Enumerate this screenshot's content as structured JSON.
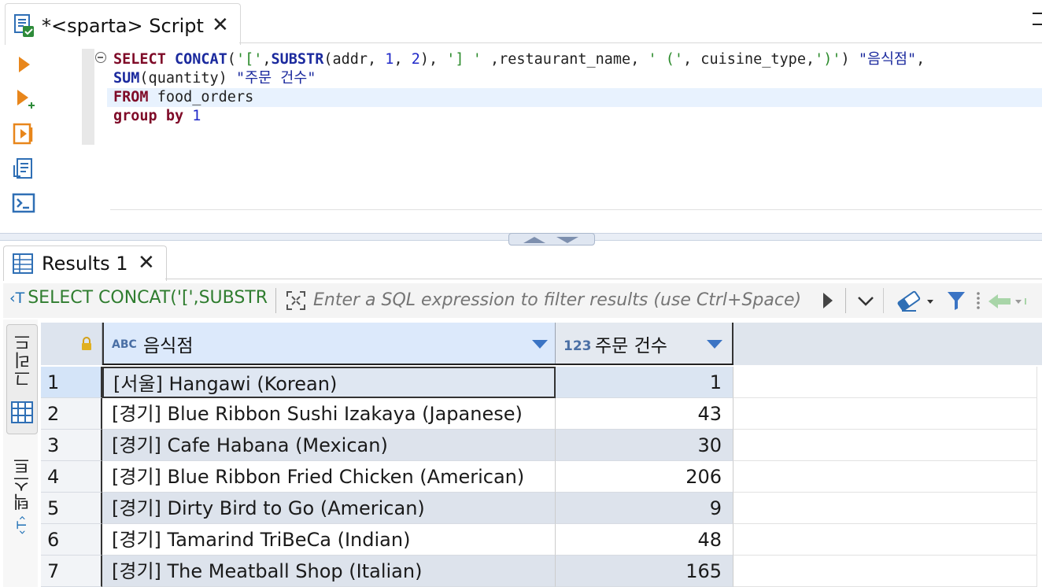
{
  "editor": {
    "tab_title": "*<sparta> Script",
    "tab_close": "✕",
    "tools": [
      "run-statement-icon",
      "run-new-tab-icon",
      "execute-script-icon",
      "explain-plan-icon",
      "console-icon"
    ],
    "code": {
      "line1": {
        "t1": "SELECT",
        "t2": " ",
        "t3": "CONCAT",
        "t4": "(",
        "t5": "'['",
        "t6": ",",
        "t7": "SUBSTR",
        "t8": "(addr, ",
        "t9": "1",
        "t10": ", ",
        "t11": "2",
        "t12": "), ",
        "t13": "'] '",
        "t14": " ,restaurant_name, ",
        "t15": "' ('",
        "t16": ", cuisine_type,",
        "t17": "')'",
        "t18": ") ",
        "t19": "\"음식점\"",
        "t20": ","
      },
      "line2": {
        "t1": "SUM",
        "t2": "(quantity) ",
        "t3": "\"주문 건수\""
      },
      "line3": {
        "t1": "FROM",
        "t2": " food_orders"
      },
      "line4": {
        "t1": "group",
        "t2": " ",
        "t3": "by",
        "t4": " ",
        "t5": "1"
      }
    }
  },
  "results": {
    "tab_title": "Results 1",
    "tab_close": "✕",
    "filter": {
      "source_icon": "‹T",
      "source_text": "SELECT CONCAT('[',SUBSTR",
      "placeholder": "Enter a SQL expression to filter results (use Ctrl+Space)"
    },
    "side_tabs": {
      "grid_label": "그리드",
      "text_label": "텍스트",
      "text_icon": "‹T›"
    },
    "columns": [
      {
        "type_badge": "ABC",
        "title": "음식점"
      },
      {
        "type_badge": "123",
        "title": "주문 건수"
      }
    ],
    "rows": [
      {
        "num": "1",
        "name": "[서울] Hangawi (Korean)",
        "qty": "1"
      },
      {
        "num": "2",
        "name": "[경기] Blue Ribbon Sushi Izakaya (Japanese)",
        "qty": "43"
      },
      {
        "num": "3",
        "name": "[경기] Cafe Habana (Mexican)",
        "qty": "30"
      },
      {
        "num": "4",
        "name": "[경기] Blue Ribbon Fried Chicken (American)",
        "qty": "206"
      },
      {
        "num": "5",
        "name": "[경기] Dirty Bird to Go (American)",
        "qty": "9"
      },
      {
        "num": "6",
        "name": "[경기] Tamarind TriBeCa (Indian)",
        "qty": "48"
      },
      {
        "num": "7",
        "name": "[경기] The Meatball Shop (Italian)",
        "qty": "165"
      }
    ]
  },
  "colors": {
    "accent": "#3b74c4",
    "keyword": "#7f0b28",
    "string": "#2a8a2a",
    "number": "#1f28c8"
  }
}
